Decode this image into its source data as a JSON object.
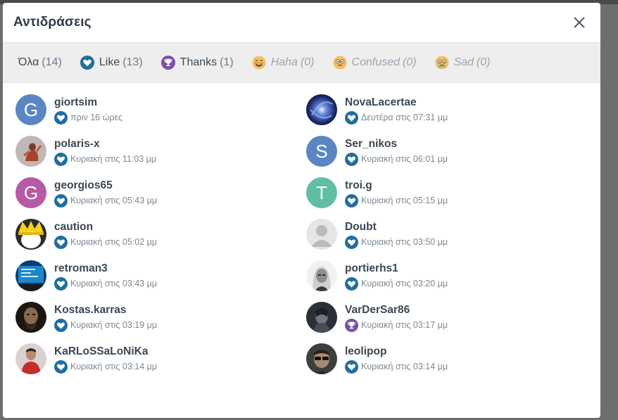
{
  "modal": {
    "title": "Αντιδράσεις"
  },
  "colors": {
    "like": "#1e6f9e",
    "thanks": "#7b4fa8",
    "tabs_bg": "#eeeeee"
  },
  "tabs": [
    {
      "label": "Όλα",
      "count": "(14)",
      "icon": "none",
      "disabled": false
    },
    {
      "label": "Like",
      "count": "(13)",
      "icon": "heart-icon",
      "disabled": false
    },
    {
      "label": "Thanks",
      "count": "(1)",
      "icon": "trophy-icon",
      "disabled": false
    },
    {
      "label": "Haha",
      "count": "(0)",
      "icon": "laugh-emoji-icon",
      "disabled": true
    },
    {
      "label": "Confused",
      "count": "(0)",
      "icon": "confused-emoji-icon",
      "disabled": true
    },
    {
      "label": "Sad",
      "count": "(0)",
      "icon": "sad-emoji-icon",
      "disabled": true
    }
  ],
  "users": [
    {
      "name": "giortsim",
      "time": "πριν 16 ώρες",
      "reaction": "heart-icon",
      "avatar": "letter",
      "letter": "G",
      "avatar_color": "#5b86c3"
    },
    {
      "name": "NovaLacertae",
      "time": "Δευτέρα στις 07:31 μμ",
      "reaction": "heart-icon",
      "avatar": "galaxy-image"
    },
    {
      "name": "polaris-x",
      "time": "Κυριακή στις 11:03 μμ",
      "reaction": "heart-icon",
      "avatar": "figure-image"
    },
    {
      "name": "Ser_nikos",
      "time": "Κυριακή στις 06:01 μμ",
      "reaction": "heart-icon",
      "avatar": "letter",
      "letter": "S",
      "avatar_color": "#5b86c3"
    },
    {
      "name": "georgios65",
      "time": "Κυριακή στις 05:43 μμ",
      "reaction": "heart-icon",
      "avatar": "letter",
      "letter": "G",
      "avatar_color": "#b75aa6"
    },
    {
      "name": "troi.g",
      "time": "Κυριακή στις 05:15 μμ",
      "reaction": "heart-icon",
      "avatar": "letter",
      "letter": "T",
      "avatar_color": "#61bea3"
    },
    {
      "name": "caution",
      "time": "Κυριακή στις 05:02 μμ",
      "reaction": "heart-icon",
      "avatar": "crown-image"
    },
    {
      "name": "Doubt",
      "time": "Κυριακή στις 03:50 μμ",
      "reaction": "heart-icon",
      "avatar": "default-person"
    },
    {
      "name": "retroman3",
      "time": "Κυριακή στις 03:43 μμ",
      "reaction": "heart-icon",
      "avatar": "screen-image"
    },
    {
      "name": "portierhs1",
      "time": "Κυριακή στις 03:20 μμ",
      "reaction": "heart-icon",
      "avatar": "witcher-image"
    },
    {
      "name": "Kostas.karras",
      "time": "Κυριακή στις 03:19 μμ",
      "reaction": "heart-icon",
      "avatar": "bearded-image"
    },
    {
      "name": "VarDerSar86",
      "time": "Κυριακή στις 03:17 μμ",
      "reaction": "trophy-icon",
      "avatar": "warrior-image"
    },
    {
      "name": "KaRLoSSaLoNiKa",
      "time": "Κυριακή στις 03:14 μμ",
      "reaction": "heart-icon",
      "avatar": "red-person-image"
    },
    {
      "name": "leolipop",
      "time": "Κυριακή στις 03:14 μμ",
      "reaction": "heart-icon",
      "avatar": "glasses-image"
    }
  ]
}
